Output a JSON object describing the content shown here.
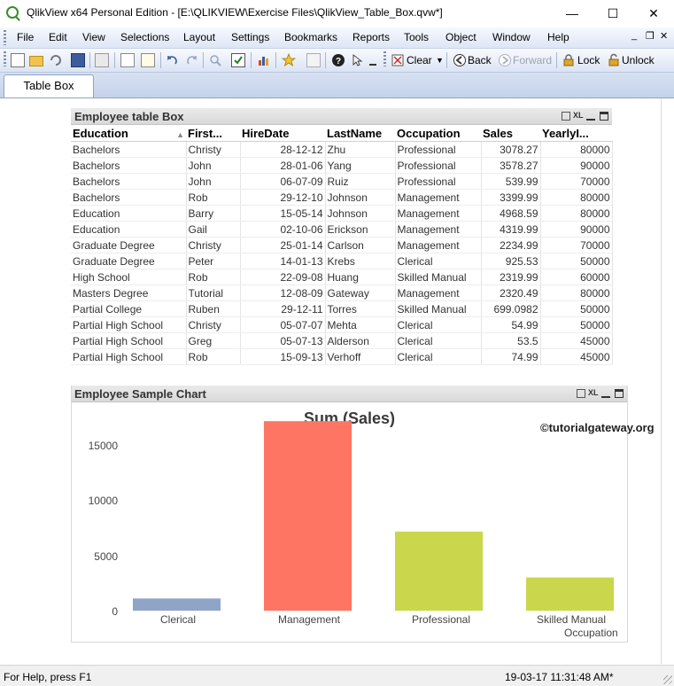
{
  "window": {
    "title": "QlikView x64 Personal Edition - [E:\\QLIKVIEW\\Exercise Files\\QlikView_Table_Box.qvw*]",
    "minimize": "—",
    "maximize": "☐",
    "close": "✕"
  },
  "menu": {
    "items": [
      "File",
      "Edit",
      "View",
      "Selections",
      "Layout",
      "Settings",
      "Bookmarks",
      "Reports",
      "Tools",
      "Object",
      "Window",
      "Help"
    ],
    "mdi_minimize": "_",
    "mdi_restore": "❐",
    "mdi_close": "✕"
  },
  "toolbar": {
    "clear_label": "Clear",
    "back_label": "Back",
    "forward_label": "Forward",
    "lock_label": "Lock",
    "unlock_label": "Unlock"
  },
  "tabs": [
    "Table Box"
  ],
  "table_box": {
    "title": "Employee table Box",
    "columns": [
      "Education",
      "First...",
      "HireDate",
      "LastName",
      "Occupation",
      "Sales",
      "YearlyI..."
    ],
    "rows": [
      [
        "Bachelors",
        "Christy",
        "28-12-12",
        "Zhu",
        "Professional",
        "3078.27",
        "80000"
      ],
      [
        "Bachelors",
        "John",
        "28-01-06",
        "Yang",
        "Professional",
        "3578.27",
        "90000"
      ],
      [
        "Bachelors",
        "John",
        "06-07-09",
        "Ruiz",
        "Professional",
        "539.99",
        "70000"
      ],
      [
        "Bachelors",
        "Rob",
        "29-12-10",
        "Johnson",
        "Management",
        "3399.99",
        "80000"
      ],
      [
        "Education",
        "Barry",
        "15-05-14",
        "Johnson",
        "Management",
        "4968.59",
        "80000"
      ],
      [
        "Education",
        "Gail",
        "02-10-06",
        "Erickson",
        "Management",
        "4319.99",
        "90000"
      ],
      [
        "Graduate Degree",
        "Christy",
        "25-01-14",
        "Carlson",
        "Management",
        "2234.99",
        "70000"
      ],
      [
        "Graduate Degree",
        "Peter",
        "14-01-13",
        "Krebs",
        "Clerical",
        "925.53",
        "50000"
      ],
      [
        "High School",
        "Rob",
        "22-09-08",
        "Huang",
        "Skilled Manual",
        "2319.99",
        "60000"
      ],
      [
        "Masters Degree",
        "Tutorial",
        "12-08-09",
        "Gateway",
        "Management",
        "2320.49",
        "80000"
      ],
      [
        "Partial College",
        "Ruben",
        "29-12-11",
        "Torres",
        "Skilled Manual",
        "699.0982",
        "50000"
      ],
      [
        "Partial High School",
        "Christy",
        "05-07-07",
        "Mehta",
        "Clerical",
        "54.99",
        "50000"
      ],
      [
        "Partial High School",
        "Greg",
        "05-07-13",
        "Alderson",
        "Clerical",
        "53.5",
        "45000"
      ],
      [
        "Partial High School",
        "Rob",
        "15-09-13",
        "Verhoff",
        "Clerical",
        "74.99",
        "45000"
      ]
    ]
  },
  "chart_panel": {
    "title": "Employee Sample Chart",
    "watermark": "©tutorialgateway.org"
  },
  "chart_data": {
    "type": "bar",
    "title": "Sum (Sales)",
    "xlabel": "Occupation",
    "ylabel": "",
    "categories": [
      "Clerical",
      "Management",
      "Professional",
      "Skilled Manual"
    ],
    "values": [
      1109.01,
      17243.55,
      7196.53,
      3019.09
    ],
    "colors": [
      "#8ea5c8",
      "#ff7563",
      "#cad64b",
      "#cad64b"
    ],
    "yticks": [
      "0",
      "5000",
      "10000",
      "15000"
    ],
    "ylim": [
      0,
      15000
    ],
    "grid": false
  },
  "status": {
    "help": "For Help, press F1",
    "datetime": "19-03-17 11:31:48 AM*"
  }
}
